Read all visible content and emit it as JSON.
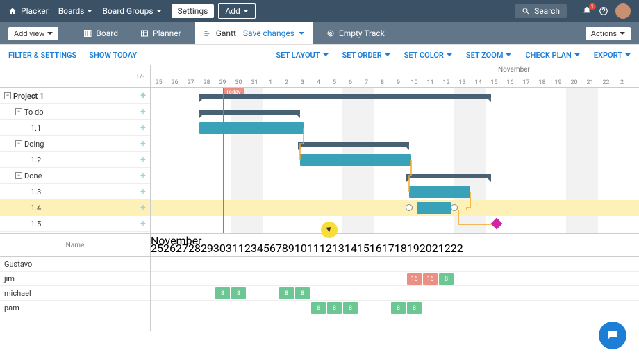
{
  "topbar": {
    "brand": "Placker",
    "nav": [
      "Boards",
      "Board Groups"
    ],
    "settings": "Settings",
    "add": "Add",
    "search": "Search",
    "notif": "1"
  },
  "tabs": {
    "addview": "Add view",
    "board": "Board",
    "planner": "Planner",
    "gantt": "Gantt",
    "save": "Save changes",
    "empty": "Empty Track",
    "actions": "Actions"
  },
  "toolbar": {
    "filter": "FILTER & SETTINGS",
    "today": "SHOW TODAY",
    "layout": "SET LAYOUT",
    "order": "SET ORDER",
    "color": "SET COLOR",
    "zoom": "SET ZOOM",
    "check": "CHECK PLAN",
    "export": "EXPORT"
  },
  "gantt": {
    "pm": "+/-",
    "month": "November",
    "days": [
      "25",
      "26",
      "27",
      "28",
      "29",
      "30",
      "31",
      "1",
      "2",
      "3",
      "4",
      "5",
      "6",
      "7",
      "8",
      "9",
      "10",
      "11",
      "12",
      "13",
      "14",
      "15",
      "16",
      "17",
      "18",
      "19",
      "20",
      "21",
      "22",
      "2"
    ],
    "today": "Today",
    "rows": [
      {
        "lvl": 0,
        "label": "Project 1",
        "tog": true
      },
      {
        "lvl": 1,
        "label": "To do",
        "tog": true
      },
      {
        "lvl": 2,
        "label": "1.1"
      },
      {
        "lvl": 1,
        "label": "Doing",
        "tog": true
      },
      {
        "lvl": 2,
        "label": "1.2"
      },
      {
        "lvl": 1,
        "label": "Done",
        "tog": true
      },
      {
        "lvl": 2,
        "label": "1.3"
      },
      {
        "lvl": 2,
        "label": "1.4",
        "hl": true
      },
      {
        "lvl": 2,
        "label": "1.5"
      }
    ]
  },
  "res": {
    "hdr": "Name",
    "month": "November",
    "rows": [
      "Gustavo",
      "jim",
      "michael",
      "pam"
    ]
  },
  "chart_data": {
    "type": "gantt-resource-combo",
    "timeline": {
      "start": "Oct 25",
      "end": "Nov 22",
      "today": "Oct 29"
    },
    "tasks": [
      {
        "id": "Project 1",
        "type": "summary",
        "start": "Oct 28",
        "end": "Nov 14"
      },
      {
        "id": "To do",
        "type": "summary",
        "start": "Oct 28",
        "end": "Nov 3"
      },
      {
        "id": "1.1",
        "type": "task",
        "start": "Oct 28",
        "end": "Nov 3"
      },
      {
        "id": "Doing",
        "type": "summary",
        "start": "Nov 3",
        "end": "Nov 9"
      },
      {
        "id": "1.2",
        "type": "task",
        "start": "Nov 3",
        "end": "Nov 9"
      },
      {
        "id": "Done",
        "type": "summary",
        "start": "Nov 9",
        "end": "Nov 14"
      },
      {
        "id": "1.3",
        "type": "task",
        "start": "Nov 9",
        "end": "Nov 12"
      },
      {
        "id": "1.4",
        "type": "task",
        "start": "Nov 10",
        "end": "Nov 12"
      },
      {
        "id": "1.5",
        "type": "milestone",
        "date": "Nov 14"
      }
    ],
    "dependencies": [
      [
        "1.1",
        "1.2"
      ],
      [
        "1.2",
        "1.3"
      ],
      [
        "1.3",
        "1.4"
      ],
      [
        "1.4",
        "1.5"
      ]
    ],
    "resource_load": [
      {
        "name": "Gustavo",
        "days": {}
      },
      {
        "name": "jim",
        "days": {
          "Nov 10": 16,
          "Nov 11": 16,
          "Nov 12": 8
        }
      },
      {
        "name": "michael",
        "days": {
          "Oct 29": 8,
          "Oct 30": 8,
          "Nov 1": 8,
          "Nov 2": 8
        }
      },
      {
        "name": "pam",
        "days": {
          "Nov 3": 8,
          "Nov 4": 8,
          "Nov 5": 8,
          "Nov 8": 8,
          "Nov 9": 8
        }
      }
    ]
  }
}
